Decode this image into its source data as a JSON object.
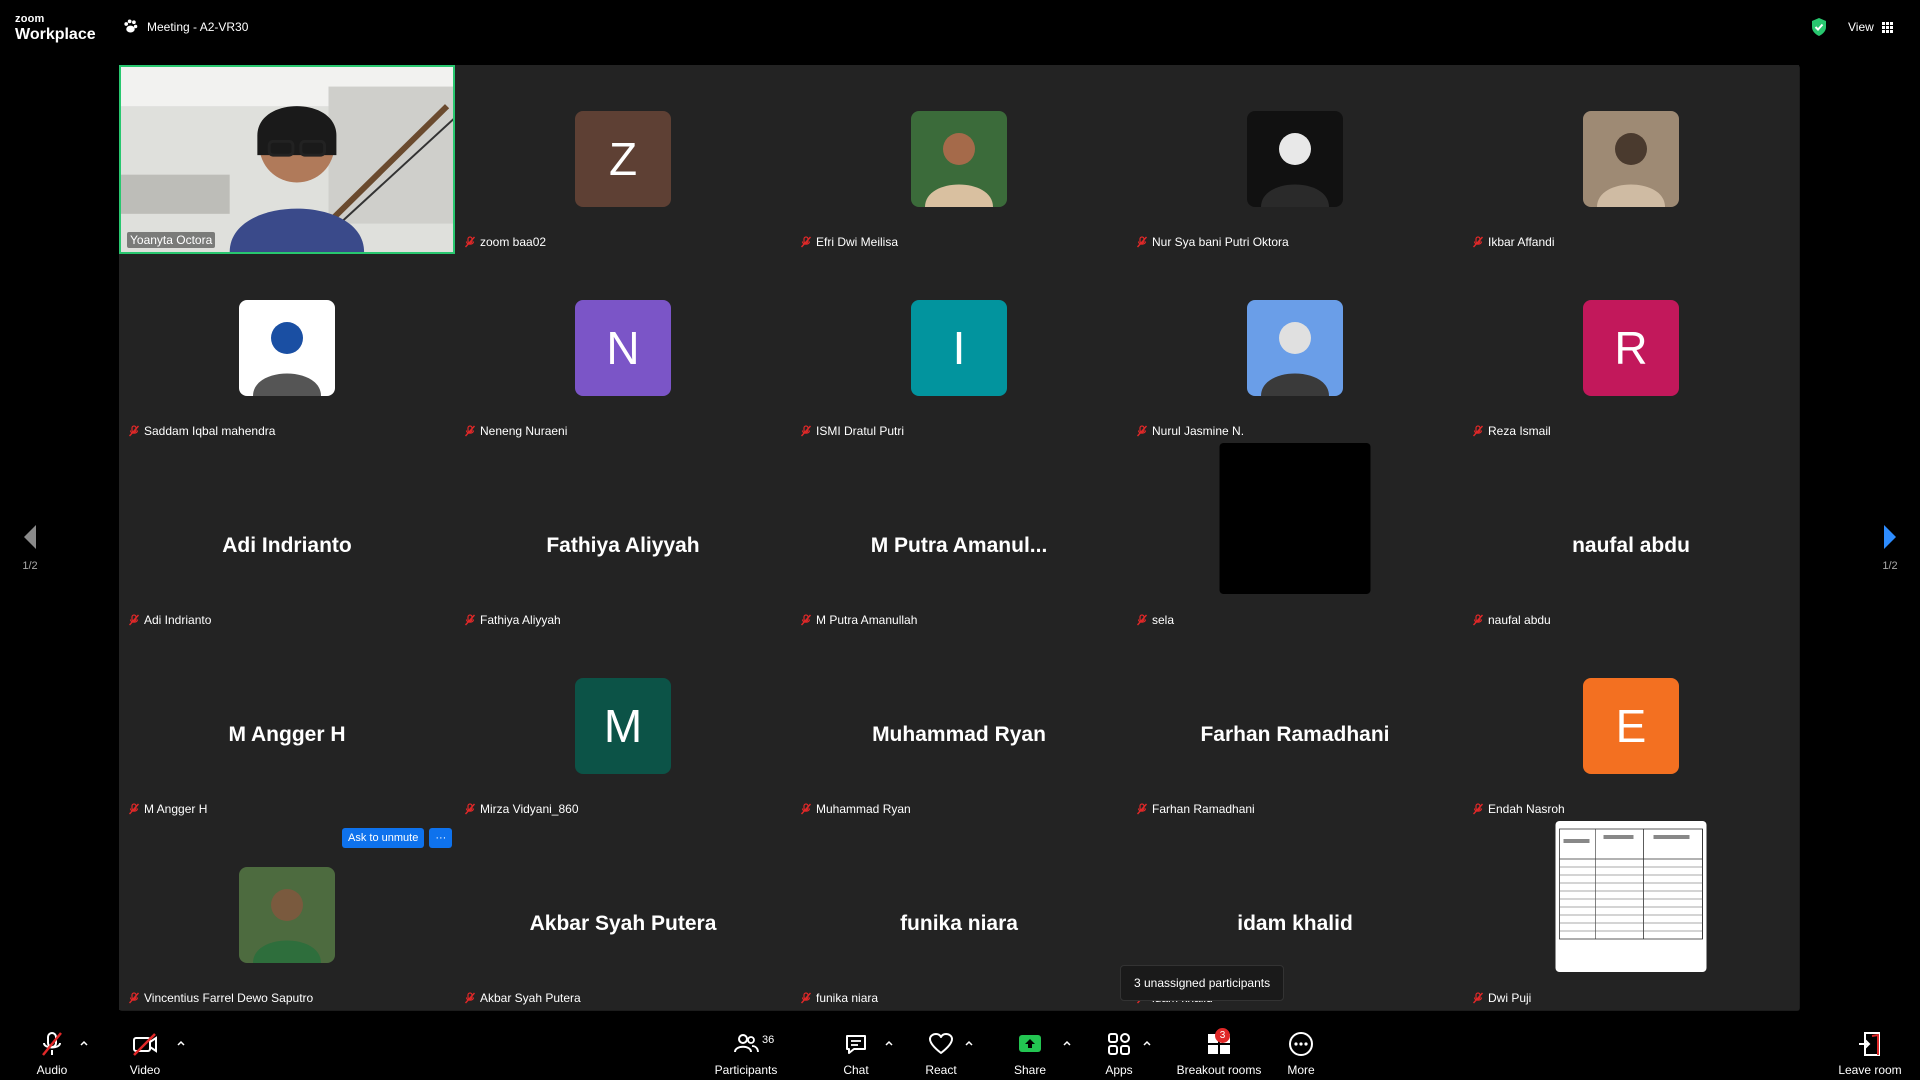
{
  "app": {
    "logo_top": "zoom",
    "logo_bottom": "Workplace",
    "meeting_title": "Meeting - A2-VR30",
    "view_label": "View"
  },
  "colors": {
    "active_border": "#28c76f",
    "accent_blue": "#0e72ed",
    "muted_red": "#e02828"
  },
  "tiles": [
    {
      "name": "Yoanyta Octora",
      "type": "video"
    },
    {
      "name": "zoom baa02",
      "type": "initial",
      "initial": "Z",
      "color": "#5e4034"
    },
    {
      "name": "Efri Dwi Meilisa",
      "type": "photo"
    },
    {
      "name": "Nur Sya bani Putri Oktora",
      "type": "photo"
    },
    {
      "name": "Ikbar Affandi",
      "type": "photo"
    },
    {
      "name": "Saddam Iqbal mahendra",
      "type": "photo"
    },
    {
      "name": "Neneng Nuraeni",
      "type": "initial",
      "initial": "N",
      "color": "#7b55c7"
    },
    {
      "name": "ISMI Dratul Putri",
      "type": "initial",
      "initial": "I",
      "color": "#02949e"
    },
    {
      "name": "Nurul Jasmine N.",
      "type": "photo"
    },
    {
      "name": "Reza Ismail",
      "type": "initial",
      "initial": "R",
      "color": "#c2185b"
    },
    {
      "name": "Adi Indrianto",
      "type": "text",
      "display": "Adi Indrianto"
    },
    {
      "name": "Fathiya Aliyyah",
      "type": "text",
      "display": "Fathiya Aliyyah"
    },
    {
      "name": "M Putra Amanullah",
      "type": "text",
      "display": "M  Putra  Amanul..."
    },
    {
      "name": "sela",
      "type": "black"
    },
    {
      "name": "naufal abdu",
      "type": "text",
      "display": "naufal abdu"
    },
    {
      "name": "M Angger H",
      "type": "text",
      "display": "M Angger H"
    },
    {
      "name": "Mirza Vidyani_860",
      "type": "initial",
      "initial": "M",
      "color": "#0c5347"
    },
    {
      "name": "Muhammad Ryan",
      "type": "text",
      "display": "Muhammad Ryan"
    },
    {
      "name": "Farhan Ramadhani",
      "type": "text",
      "display": "Farhan Ramadhani"
    },
    {
      "name": "Endah Nasroh",
      "type": "initial",
      "initial": "E",
      "color": "#f37021"
    },
    {
      "name": "Vincentius Farrel Dewo Saputro",
      "type": "photo"
    },
    {
      "name": "Akbar Syah Putera",
      "type": "text",
      "display": "Akbar Syah Putera"
    },
    {
      "name": "funika niara",
      "type": "text",
      "display": "funika niara"
    },
    {
      "name": "idam khalid",
      "type": "text",
      "display": "idam khalid"
    },
    {
      "name": "Dwi Puji",
      "type": "document"
    }
  ],
  "ask_unmute": {
    "label": "Ask to unmute",
    "more": "···"
  },
  "tooltip": "3 unassigned participants",
  "pager": {
    "left": "1/2",
    "right": "1/2"
  },
  "toolbar": {
    "audio": "Audio",
    "video": "Video",
    "participants": "Participants",
    "participant_count": "36",
    "chat": "Chat",
    "react": "React",
    "share": "Share",
    "apps": "Apps",
    "breakout": "Breakout rooms",
    "breakout_badge": "3",
    "more": "More",
    "leave": "Leave room"
  }
}
